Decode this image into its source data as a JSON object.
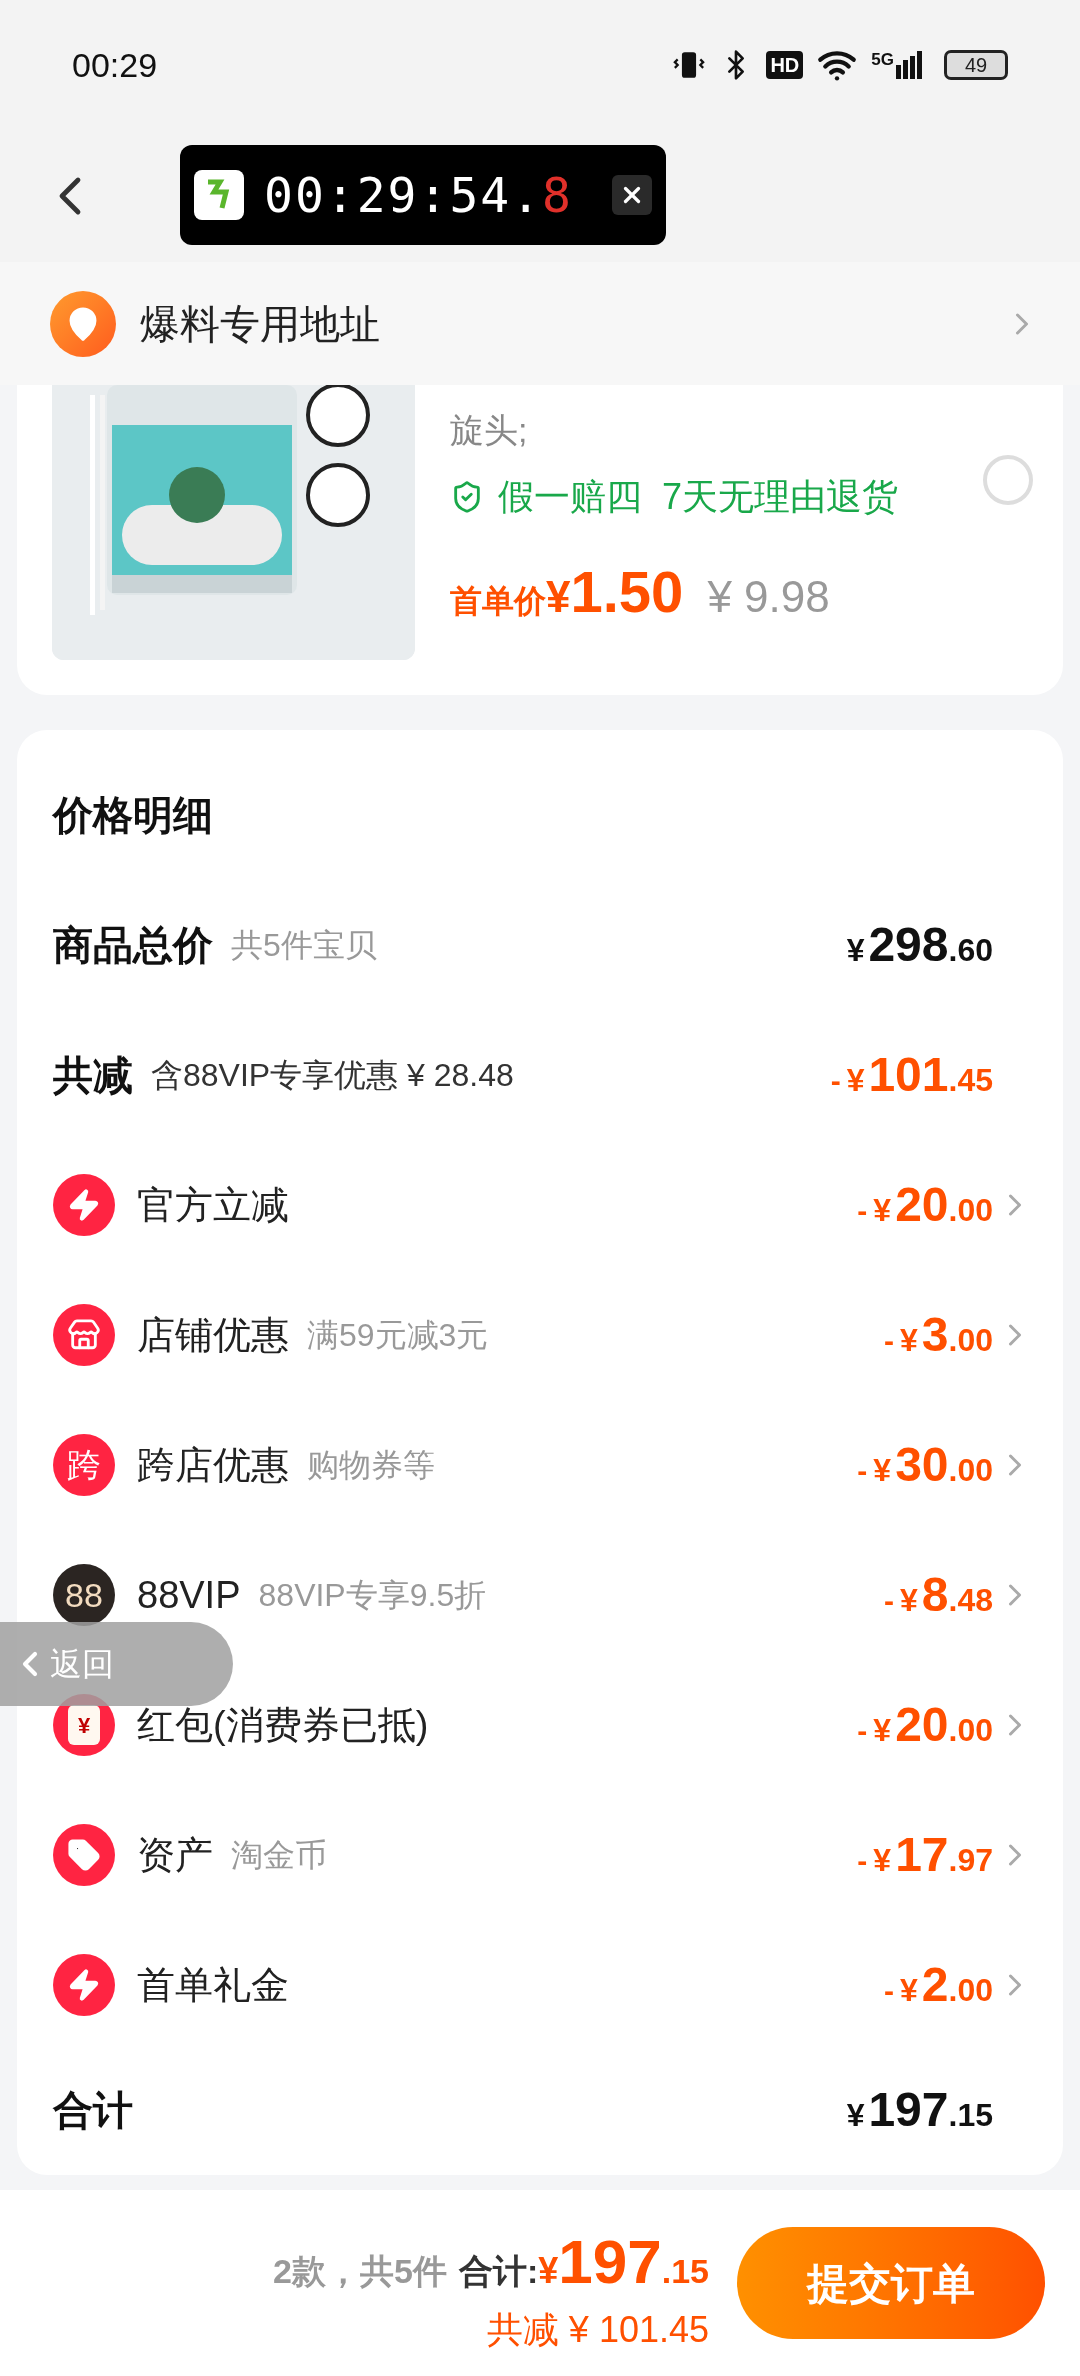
{
  "status_bar": {
    "time": "00:29",
    "hd": "HD",
    "network": "5G",
    "battery": "49"
  },
  "timer": {
    "main": "00:29:54.",
    "tenths": "8"
  },
  "address": {
    "label": "爆料专用地址"
  },
  "product": {
    "title_tail": "旋头;",
    "guarantees": [
      "假一赔四",
      "7天无理由退货"
    ],
    "price_label": "首单价",
    "price_currency": "¥",
    "price": "1.50",
    "original_price": "¥ 9.98",
    "selected": false
  },
  "price_detail": {
    "title": "价格明细",
    "rows": [
      {
        "kind": "summary",
        "title": "商品总价",
        "note": "共5件宝贝",
        "note_strong": false,
        "currency": "¥",
        "integer": "298",
        "decimal": ".60"
      },
      {
        "kind": "summary",
        "title": "共减",
        "note": "含88VIP专享优惠 ¥ 28.48",
        "note_strong": true,
        "sign": "-",
        "currency": "¥",
        "integer": "101",
        "decimal": ".45"
      },
      {
        "kind": "discount",
        "title": "官方立减",
        "color": "#ff2442",
        "sign": "-",
        "currency": "¥",
        "integer": "20",
        "decimal": ".00"
      },
      {
        "kind": "discount",
        "title": "店铺优惠",
        "note": "满59元减3元",
        "color": "#ff2442",
        "sign": "-",
        "currency": "¥",
        "integer": "3",
        "decimal": ".00"
      },
      {
        "kind": "discount",
        "title": "跨店优惠",
        "note": "购物券等",
        "badge": "跨",
        "color": "#ff2442",
        "sign": "-",
        "currency": "¥",
        "integer": "30",
        "decimal": ".00"
      },
      {
        "kind": "discount",
        "title": "88VIP",
        "note": "88VIP专享9.5折",
        "badge": "88",
        "color": "#2b2522",
        "sign": "-",
        "currency": "¥",
        "integer": "8",
        "decimal": ".48"
      },
      {
        "kind": "discount",
        "title": "红包(消费券已抵)",
        "badge": "¥",
        "color": "#ff2442",
        "sign": "-",
        "currency": "¥",
        "integer": "20",
        "decimal": ".00"
      },
      {
        "kind": "discount",
        "title": "资产",
        "note": "淘金币",
        "color": "#ff2442",
        "sign": "-",
        "currency": "¥",
        "integer": "17",
        "decimal": ".97"
      },
      {
        "kind": "discount",
        "title": "首单礼金",
        "color": "#ff2442",
        "sign": "-",
        "currency": "¥",
        "integer": "2",
        "decimal": ".00"
      },
      {
        "kind": "total",
        "title": "合计",
        "currency": "¥",
        "integer": "197",
        "decimal": ".15"
      }
    ]
  },
  "footer": {
    "count": "2款，共5件",
    "total_label": "合计:",
    "currency": "¥",
    "integer": "197",
    "decimal": ".15",
    "saved": "共减 ¥ 101.45",
    "submit": "提交订单"
  },
  "back_pill": {
    "label": "返回"
  }
}
